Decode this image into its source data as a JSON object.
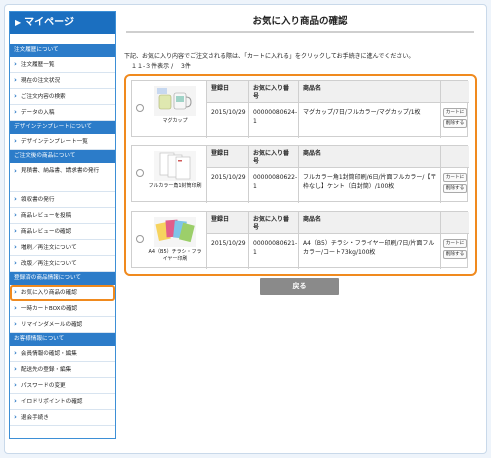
{
  "sidebar": {
    "title": "マイページ",
    "sections": [
      {
        "label": "注文履歴について",
        "items": [
          "注文履歴一覧",
          "現在の注文状況",
          "ご注文内容の検索",
          "データの入稿"
        ]
      },
      {
        "label": "デザインテンプレートについて",
        "items": [
          "デザインテンプレート一覧"
        ]
      },
      {
        "label": "ご注文後の商品について",
        "items": [
          "見積書、納品書、請求書の発行",
          "領収書の発行",
          "商品レビューを投稿",
          "商品レビューの確認",
          "増刷／再注文について",
          "改版／再注文について"
        ]
      },
      {
        "label": "登録済の商品情報について",
        "items": [
          "お気に入り商品の確認",
          "一時カートBOXの確認",
          "リマインダメールの確認"
        ]
      },
      {
        "label": "お客様情報について",
        "items": [
          "会員情報の確認・編集",
          "配送先の登録・編集",
          "パスワードの変更",
          "イロドリポイントの確認",
          "退会手続き"
        ]
      }
    ]
  },
  "main": {
    "title": "お気に入り商品の確認",
    "notice": "下記、お気に入り内容でご注文される際は、「カートに入れる」をクリックしてお手続きに進んでください。",
    "count": "１１-３件表示 /　 3件",
    "headers": {
      "date": "登録日",
      "number": "お気に入り番号",
      "name": "商品名"
    },
    "actions": {
      "add_to_cart": "カートに",
      "delete": "削除する"
    },
    "items": [
      {
        "thumb_caption": "マグカップ",
        "date": "2015/10/29",
        "number": "00000080624-1",
        "name": "マグカップ/7日/フルカラー/マグカップ/1枚"
      },
      {
        "thumb_caption": "フルカラー角1封筒印刷",
        "date": "2015/10/29",
        "number": "00000080622-1",
        "name": "フルカラー角1封筒印刷/6日/片面フルカラー/【〒枠なし】ケント（白封筒）/100枚"
      },
      {
        "thumb_caption": "A4（B5）チラシ・フライヤー印刷",
        "date": "2015/10/29",
        "number": "00000080621-1",
        "name": "A4（B5）チラシ・フライヤー印刷/7日/片面フルカラー/コート73kg/100枚"
      }
    ],
    "back_label": "戻る"
  },
  "colors": {
    "brand": "#1b6fc0",
    "highlight": "#f08a1e"
  }
}
